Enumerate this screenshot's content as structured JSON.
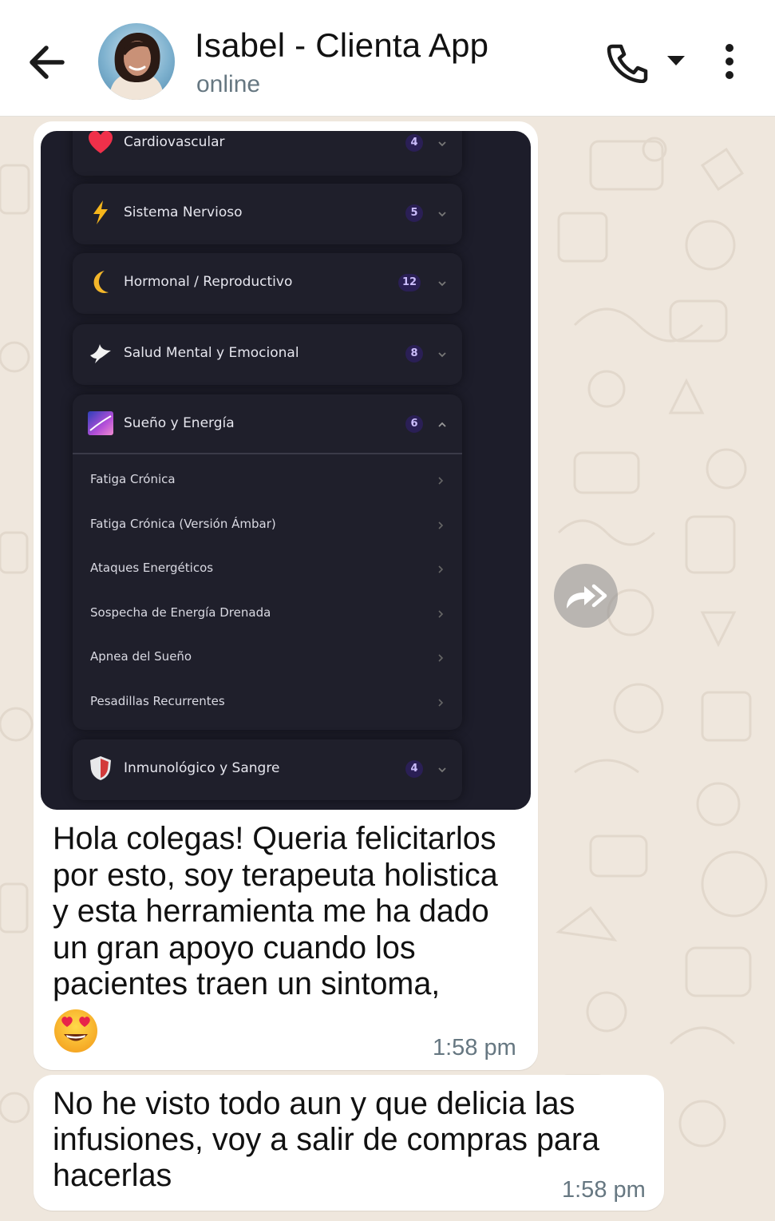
{
  "header": {
    "contact_name": "Isabel - Clienta App",
    "status": "online",
    "back_icon": "arrow-left-icon",
    "call_icon": "phone-icon",
    "dropdown_icon": "caret-down-icon",
    "menu_icon": "more-vertical-icon"
  },
  "messages": [
    {
      "image": {
        "categories": [
          {
            "label": "Cardiovascular",
            "count": "4",
            "icon": "heart-icon",
            "expanded": false
          },
          {
            "label": "Sistema Nervioso",
            "count": "5",
            "icon": "lightning-icon",
            "expanded": false
          },
          {
            "label": "Hormonal / Reproductivo",
            "count": "12",
            "icon": "moon-icon",
            "expanded": false
          },
          {
            "label": "Salud Mental y Emocional",
            "count": "8",
            "icon": "dove-icon",
            "expanded": false
          },
          {
            "label": "Sueño y Energía",
            "count": "6",
            "icon": "night-sky-icon",
            "expanded": true
          },
          {
            "label": "Inmunológico y Sangre",
            "count": "4",
            "icon": "shield-icon",
            "expanded": false
          }
        ],
        "sub_items": [
          "Fatiga Crónica",
          "Fatiga Crónica (Versión Ámbar)",
          "Ataques Energéticos",
          "Sospecha de Energía Drenada",
          "Apnea del Sueño",
          "Pesadillas Recurrentes"
        ]
      },
      "caption_lines": [
        "Hola colegas! Queria felicitarlos",
        "por esto, soy terapeuta holistica",
        "y esta herramienta me ha dado",
        "un gran apoyo cuando los",
        "pacientes traen un sintoma,"
      ],
      "emoji": "heart-eyes-emoji",
      "time": "1:58 pm"
    },
    {
      "text_lines": [
        "No he visto todo aun y que delicia las",
        "infusiones, voy a salir de compras para",
        "hacerlas"
      ],
      "time": "1:58 pm"
    }
  ],
  "forward_icon": "forward-icon",
  "colors": {
    "header_bg": "#ffffff",
    "chat_bg": "#efe7dd",
    "bubble_bg": "#ffffff",
    "card_bg": "#1d1d2a",
    "badge_bg": "#2a1f55",
    "badge_text": "#cbbdfc",
    "timestamp": "#667781"
  }
}
